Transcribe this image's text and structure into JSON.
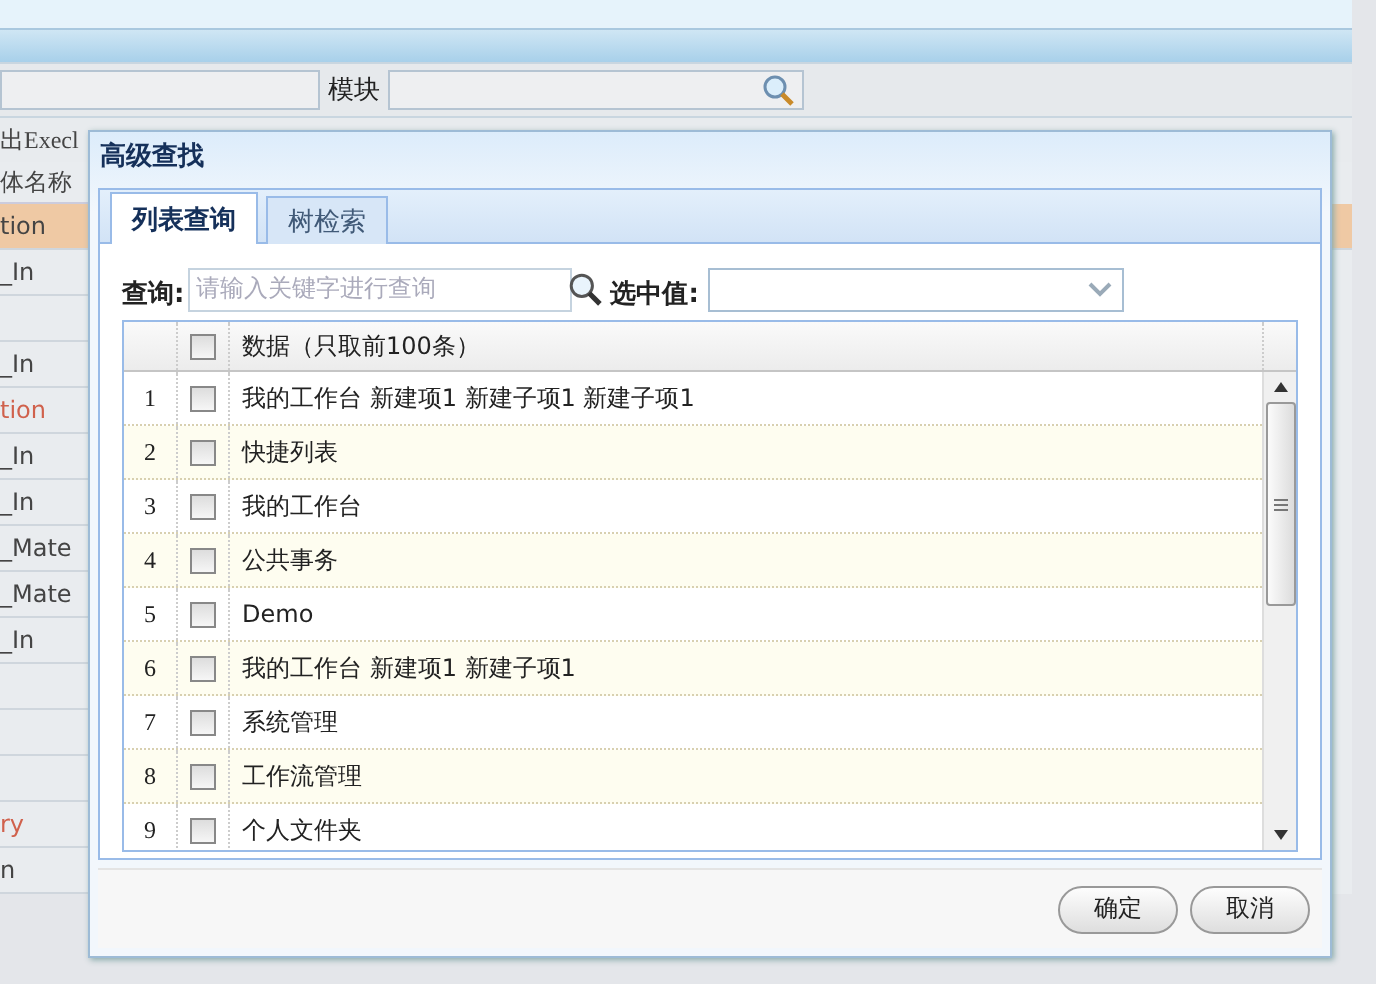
{
  "background": {
    "module_label": "模块",
    "toolbar_item": "出Execl",
    "column_header": "体名称",
    "cells": [
      {
        "text": "tion",
        "kind": "highlight"
      },
      {
        "text": "_In",
        "kind": "normal"
      },
      {
        "kind": "normal"
      },
      {
        "text": "_In",
        "kind": "normal"
      },
      {
        "text": "tion",
        "kind": "alert"
      },
      {
        "text": "_In",
        "kind": "normal"
      },
      {
        "text": "_In",
        "kind": "normal"
      },
      {
        "text": "_Mate",
        "kind": "normal"
      },
      {
        "text": "_Mate",
        "kind": "normal"
      },
      {
        "text": "_In",
        "kind": "normal"
      },
      {
        "kind": "normal"
      },
      {
        "kind": "normal"
      },
      {
        "kind": "normal"
      },
      {
        "text": "ry",
        "kind": "alert"
      },
      {
        "text": "n",
        "kind": "normal"
      }
    ]
  },
  "dialog": {
    "title": "高级查找",
    "tabs": [
      {
        "label": "列表查询",
        "selected": true
      },
      {
        "label": "树检索",
        "selected": false
      }
    ],
    "query_label": "查询:",
    "query_placeholder": "请输入关键字进行查询",
    "selected_value_label": "选中值:",
    "grid": {
      "header": "数据（只取前100条）",
      "header_checked": false,
      "rows": [
        {
          "num": "1",
          "text": "我的工作台 新建项1 新建子项1 新建子项1",
          "checked": false
        },
        {
          "num": "2",
          "text": "快捷列表",
          "checked": false
        },
        {
          "num": "3",
          "text": "我的工作台",
          "checked": false
        },
        {
          "num": "4",
          "text": "公共事务",
          "checked": false
        },
        {
          "num": "5",
          "text": "Demo",
          "checked": false
        },
        {
          "num": "6",
          "text": "我的工作台 新建项1 新建子项1",
          "checked": false
        },
        {
          "num": "7",
          "text": "系统管理",
          "checked": false
        },
        {
          "num": "8",
          "text": "工作流管理",
          "checked": false
        },
        {
          "num": "9",
          "text": "个人文件夹",
          "checked": false
        }
      ]
    },
    "buttons": [
      "确定",
      "取消"
    ]
  }
}
